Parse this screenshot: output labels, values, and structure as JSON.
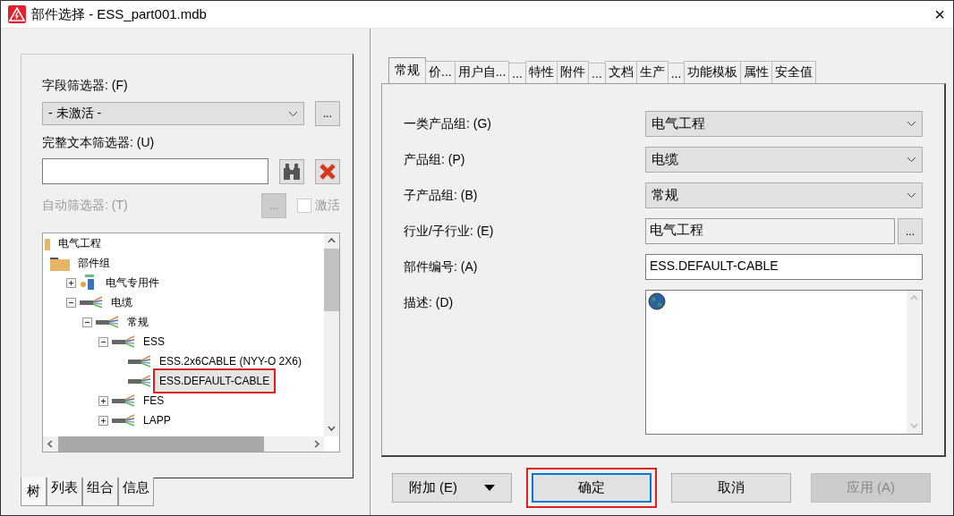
{
  "window": {
    "title": "部件选择 - ESS_part001.mdb",
    "close": "×"
  },
  "filters": {
    "field_filter": {
      "label": "字段筛选器: (F)",
      "value": "- 未激活 -",
      "more": "..."
    },
    "text_filter": {
      "label": "完整文本筛选器: (U)"
    },
    "auto_filter": {
      "label": "自动筛选器: (T)",
      "more": "...",
      "disabled": true,
      "checkbox_label": "激活",
      "checked": false
    }
  },
  "tree": [
    {
      "label": "电气工程",
      "kind": "root",
      "children": [
        {
          "label": "部件组",
          "kind": "folder",
          "children": [
            {
              "label": "电气专用件",
              "kind": "device",
              "expanded": false
            },
            {
              "label": "电缆",
              "kind": "cable",
              "expanded": true,
              "children": [
                {
                  "label": "常规",
                  "kind": "cable",
                  "expanded": true,
                  "children": [
                    {
                      "label": "ESS",
                      "kind": "cable",
                      "expanded": true,
                      "children": [
                        {
                          "label": "ESS.2x6CABLE (NYY-O 2X6)",
                          "kind": "cable",
                          "selected": false,
                          "highlighted": false
                        },
                        {
                          "label": "ESS.DEFAULT-CABLE",
                          "kind": "cable",
                          "selected": true,
                          "highlighted": true
                        }
                      ]
                    },
                    {
                      "label": "FES",
                      "kind": "cable",
                      "expanded": false
                    },
                    {
                      "label": "LAPP",
                      "kind": "cable",
                      "expanded": false
                    }
                  ]
                }
              ]
            }
          ]
        }
      ]
    }
  ],
  "left_tabs": [
    {
      "label": "树",
      "selected": true
    },
    {
      "label": "列表",
      "selected": false
    },
    {
      "label": "组合",
      "selected": false
    },
    {
      "label": "信息",
      "selected": false
    }
  ],
  "tabs": [
    {
      "label": "常规",
      "selected": true
    },
    {
      "label": "价...",
      "selected": false
    },
    {
      "label": "用户自...",
      "selected": false
    },
    {
      "label": "...",
      "selected": false
    },
    {
      "label": "特性",
      "selected": false
    },
    {
      "label": "附件",
      "selected": false
    },
    {
      "label": "...",
      "selected": false
    },
    {
      "label": "文档",
      "selected": false
    },
    {
      "label": "生产",
      "selected": false
    },
    {
      "label": "...",
      "selected": false
    },
    {
      "label": "功能模板",
      "selected": false
    },
    {
      "label": "属性",
      "selected": false
    },
    {
      "label": "安全值",
      "selected": false
    }
  ],
  "fields": [
    {
      "kind": "select",
      "label": "一类产品组: (G)",
      "value": "电气工程"
    },
    {
      "kind": "select",
      "label": "产品组: (P)",
      "value": "电缆"
    },
    {
      "kind": "select",
      "label": "子产品组: (B)",
      "value": "常规"
    },
    {
      "kind": "readonly",
      "label": "行业/子行业: (E)",
      "value": "电气工程",
      "more": "..."
    },
    {
      "kind": "text",
      "label": "部件编号: (A)",
      "value": "ESS.DEFAULT-CABLE"
    },
    {
      "kind": "multiline",
      "label": "描述: (D)"
    }
  ],
  "buttons": [
    {
      "kind": "split",
      "label": "附加 (E)",
      "disabled": false,
      "highlighted": false
    },
    {
      "kind": "default",
      "label": "确定",
      "disabled": false,
      "highlighted": true
    },
    {
      "kind": "normal",
      "label": "取消",
      "disabled": false,
      "highlighted": false
    },
    {
      "kind": "normal",
      "label": "应用 (A)",
      "disabled": true,
      "highlighted": false
    }
  ]
}
